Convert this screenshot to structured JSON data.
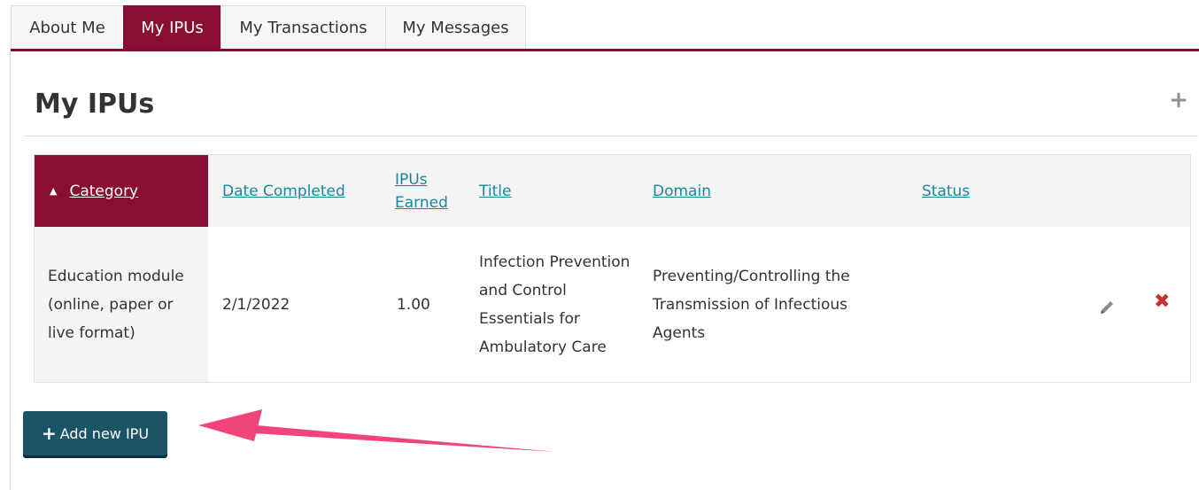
{
  "tabs": [
    {
      "label": "About Me",
      "active": false
    },
    {
      "label": "My IPUs",
      "active": true
    },
    {
      "label": "My Transactions",
      "active": false
    },
    {
      "label": "My Messages",
      "active": false
    }
  ],
  "page": {
    "title": "My IPUs",
    "add_icon": "plus-icon"
  },
  "table": {
    "headers": {
      "category": "Category",
      "date_completed": "Date Completed",
      "ipus_earned_line1": "IPUs",
      "ipus_earned_line2": "Earned",
      "title": "Title",
      "domain": "Domain",
      "status": "Status"
    },
    "sort": {
      "column": "Category",
      "direction": "ascending",
      "icon": "sort-ascending-icon"
    },
    "rows": [
      {
        "category": "Education module (online, paper or live format)",
        "date_completed": "2/1/2022",
        "ipus_earned": "1.00",
        "title": "Infection Prevention and Control Essentials for Ambulatory Care",
        "domain": "Preventing/Controlling the Transmission of Infectious Agents",
        "status": "",
        "actions": [
          "pencil-icon",
          "delete-icon"
        ]
      }
    ]
  },
  "add_button": {
    "label": "Add new IPU",
    "icon": "plus-icon"
  },
  "colors": {
    "brand": "#8a0e33",
    "link": "#1a86a0",
    "button": "#1b5565",
    "delete": "#c9302c",
    "annotation_arrow": "#f0457a"
  }
}
